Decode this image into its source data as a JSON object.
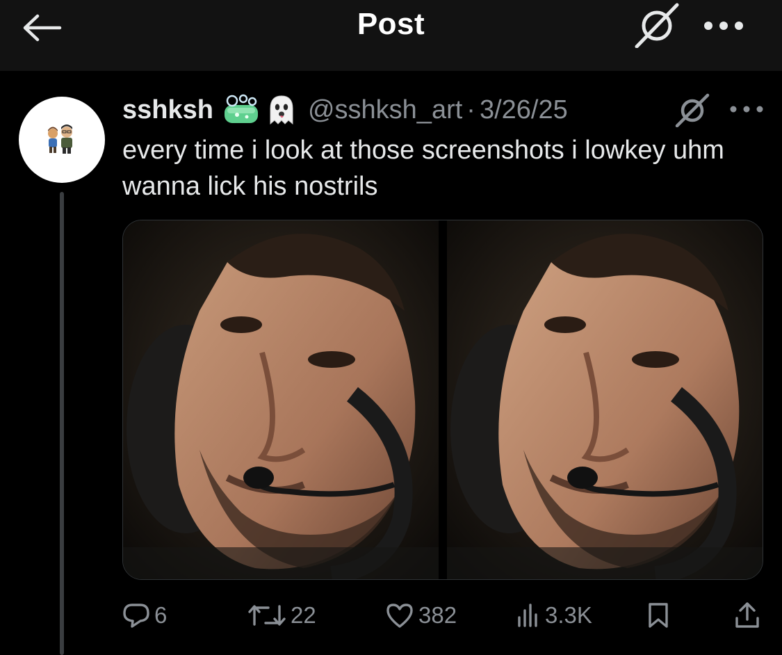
{
  "header": {
    "title": "Post",
    "back_icon": "arrow-left-icon",
    "grok_icon": "grok-icon",
    "more_icon": "more-horizontal-icon"
  },
  "tweet": {
    "display_name": "sshksh",
    "name_emojis": [
      "soap-bubbles-emoji",
      "ghost-emoji"
    ],
    "handle": "@sshksh_art",
    "separator": "·",
    "date": "3/26/25",
    "text": "every time i look at those screenshots i lowkey uhm wanna lick his nostrils",
    "media": [
      {
        "icon": "photo-man-with-headset"
      },
      {
        "icon": "photo-man-with-headset"
      }
    ]
  },
  "actions": {
    "replies": "6",
    "reposts": "22",
    "likes": "382",
    "views": "3.3K"
  },
  "colors": {
    "background": "#000000",
    "topbar": "#121212",
    "text": "#e7e9ea",
    "muted": "#8b9096",
    "thread_line": "#3a3d40"
  }
}
